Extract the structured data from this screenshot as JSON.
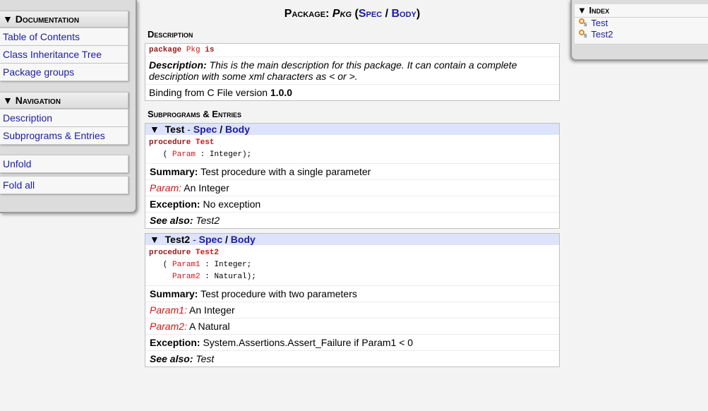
{
  "sidebar": {
    "documentation": {
      "title": "Documentation",
      "items": [
        "Table of Contents",
        "Class Inheritance Tree",
        "Package groups"
      ]
    },
    "navigation": {
      "title": "Navigation",
      "items": [
        "Description",
        "Subprograms & Entries"
      ]
    },
    "actions": {
      "unfold": "Unfold",
      "fold_all": "Fold all"
    }
  },
  "index": {
    "title": "Index",
    "items": [
      "Test",
      "Test2"
    ]
  },
  "page": {
    "title_prefix": "Package:",
    "package_name": "Pkg",
    "spec_label": "Spec",
    "body_label": "Body"
  },
  "description": {
    "heading": "Description",
    "code_kw1": "package",
    "code_name": "Pkg",
    "code_kw2": "is",
    "desc_label": "Description:",
    "desc_text": "This is the main description for this package. It can contain a complete desciription with some xml characters as < or >.",
    "binding_text": "Binding from C File version",
    "binding_version": "1.0.0"
  },
  "subprograms": {
    "heading": "Subprograms & Entries",
    "entries": [
      {
        "name": "Test",
        "spec": "Spec",
        "body": "Body",
        "code_kw": "procedure",
        "code_name": "Test",
        "params": [
          {
            "name": "Param",
            "type": "Integer);"
          }
        ],
        "summary_label": "Summary:",
        "summary": "Test procedure with a single parameter",
        "param_docs": [
          {
            "name": "Param:",
            "text": "An Integer"
          }
        ],
        "exception_label": "Exception:",
        "exception": "No exception",
        "see_also_label": "See also:",
        "see_also": "Test2"
      },
      {
        "name": "Test2",
        "spec": "Spec",
        "body": "Body",
        "code_kw": "procedure",
        "code_name": "Test2",
        "params": [
          {
            "name": "Param1",
            "type": "Integer;"
          },
          {
            "name": "Param2",
            "type": "Natural);"
          }
        ],
        "summary_label": "Summary:",
        "summary": "Test procedure with two parameters",
        "param_docs": [
          {
            "name": "Param1:",
            "text": "An Integer"
          },
          {
            "name": "Param2:",
            "text": "A Natural"
          }
        ],
        "exception_label": "Exception:",
        "exception": "System.Assertions.Assert_Failure if Param1 < 0",
        "see_also_label": "See also:",
        "see_also": "Test"
      }
    ]
  }
}
